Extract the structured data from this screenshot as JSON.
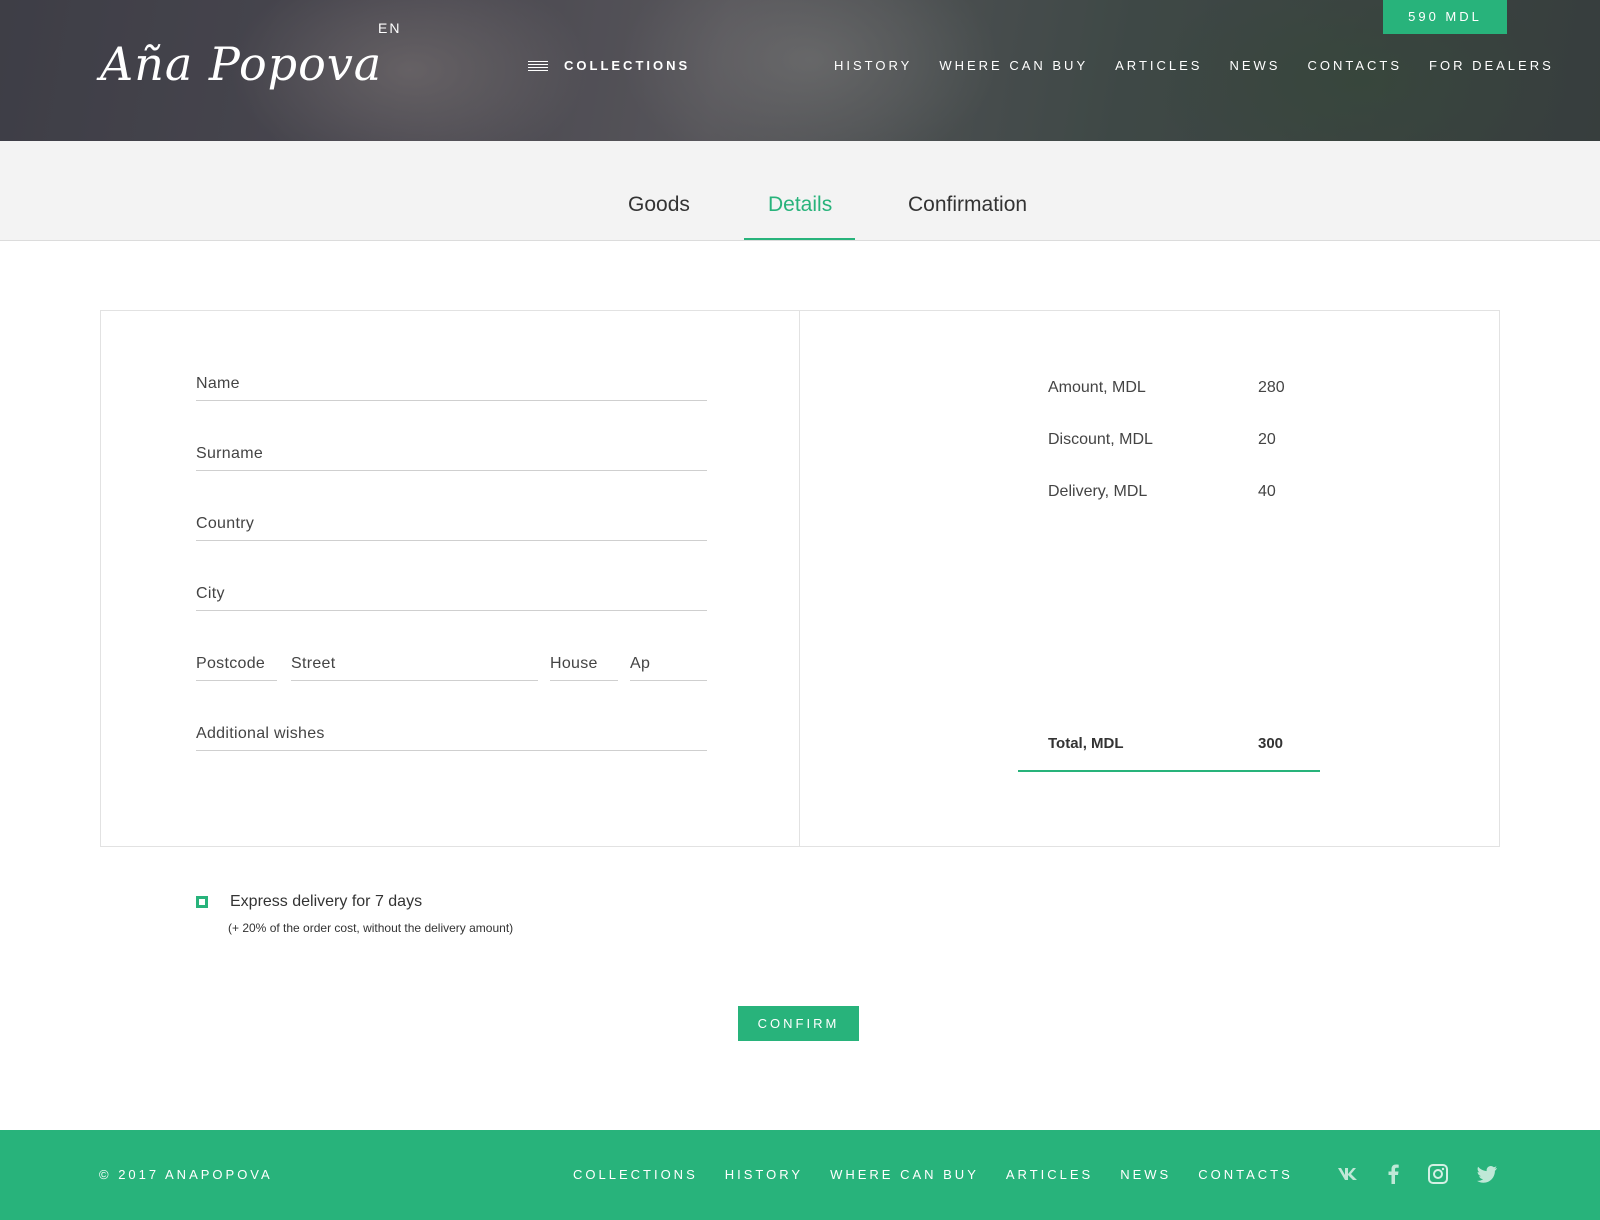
{
  "header": {
    "logo_text": "Aña Popova",
    "language": "EN",
    "collections_label": "COLLECTIONS",
    "nav": [
      "HISTORY",
      "WHERE CAN BUY",
      "ARTICLES",
      "NEWS",
      "CONTACTS",
      "FOR DEALERS"
    ],
    "cart_label": "590 MDL"
  },
  "steps": {
    "items": [
      "Goods",
      "Details",
      "Confirmation"
    ],
    "active": "Details"
  },
  "form": {
    "name_placeholder": "Name",
    "surname_placeholder": "Surname",
    "country_placeholder": "Country",
    "city_placeholder": "City",
    "postcode_placeholder": "Postcode",
    "street_placeholder": "Street",
    "house_placeholder": "House",
    "ap_placeholder": "Ap",
    "wishes_placeholder": "Additional wishes"
  },
  "summary": {
    "amount_label": "Amount, MDL",
    "amount_value": "280",
    "discount_label": "Discount, MDL",
    "discount_value": "20",
    "delivery_label": "Delivery, MDL",
    "delivery_value": "40",
    "total_label": "Total, MDL",
    "total_value": "300"
  },
  "express": {
    "label": "Express delivery for 7 days",
    "note": "(+ 20% of the order cost, without the delivery amount)",
    "checked": true
  },
  "confirm_label": "CONFIRM",
  "footer": {
    "copyright": "© 2017  ANAPOPOVA",
    "nav": [
      "COLLECTIONS",
      "HISTORY",
      "WHERE CAN BUY",
      "ARTICLES",
      "NEWS",
      "CONTACTS"
    ],
    "social": [
      "vk-icon",
      "facebook-icon",
      "instagram-icon",
      "twitter-icon"
    ]
  },
  "colors": {
    "accent": "#28b37b",
    "steps_bg": "#f3f3f3",
    "text": "#333333"
  }
}
